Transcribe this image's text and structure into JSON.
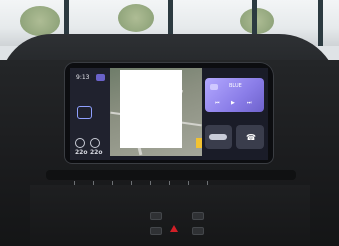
{
  "infotainment": {
    "clock": "9:13",
    "temperature_left": "22o",
    "temperature_right": "22o",
    "tile_label": "BLUE"
  },
  "colors": {
    "accent": "#8a7de8",
    "hazard": "#d21f27",
    "nav_blue": "#3a7cff"
  }
}
